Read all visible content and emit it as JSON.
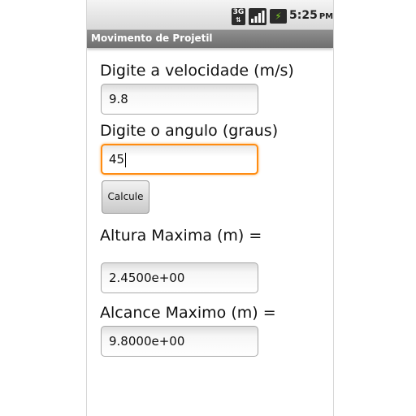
{
  "status_bar": {
    "network_type": "3G",
    "network_arrows": "⇅",
    "battery_glyph": "⚡",
    "time": "5:25",
    "ampm": "PM"
  },
  "app": {
    "title": "Movimento de Projetil"
  },
  "form": {
    "velocity_label": "Digite a velocidade (m/s)",
    "velocity_value": "9.8",
    "angle_label": "Digite o angulo (graus)",
    "angle_value": "45",
    "calculate_button": "Calcule"
  },
  "results": {
    "max_height_label": "Altura Maxima (m) =",
    "max_height_value": "2.4500e+00",
    "max_range_label": "Alcance Maximo (m) =",
    "max_range_value": "9.8000e+00"
  },
  "colors": {
    "focus_accent": "#ff8c12",
    "title_bar": "#7a7a7a",
    "battery_accent": "#7fd321"
  }
}
